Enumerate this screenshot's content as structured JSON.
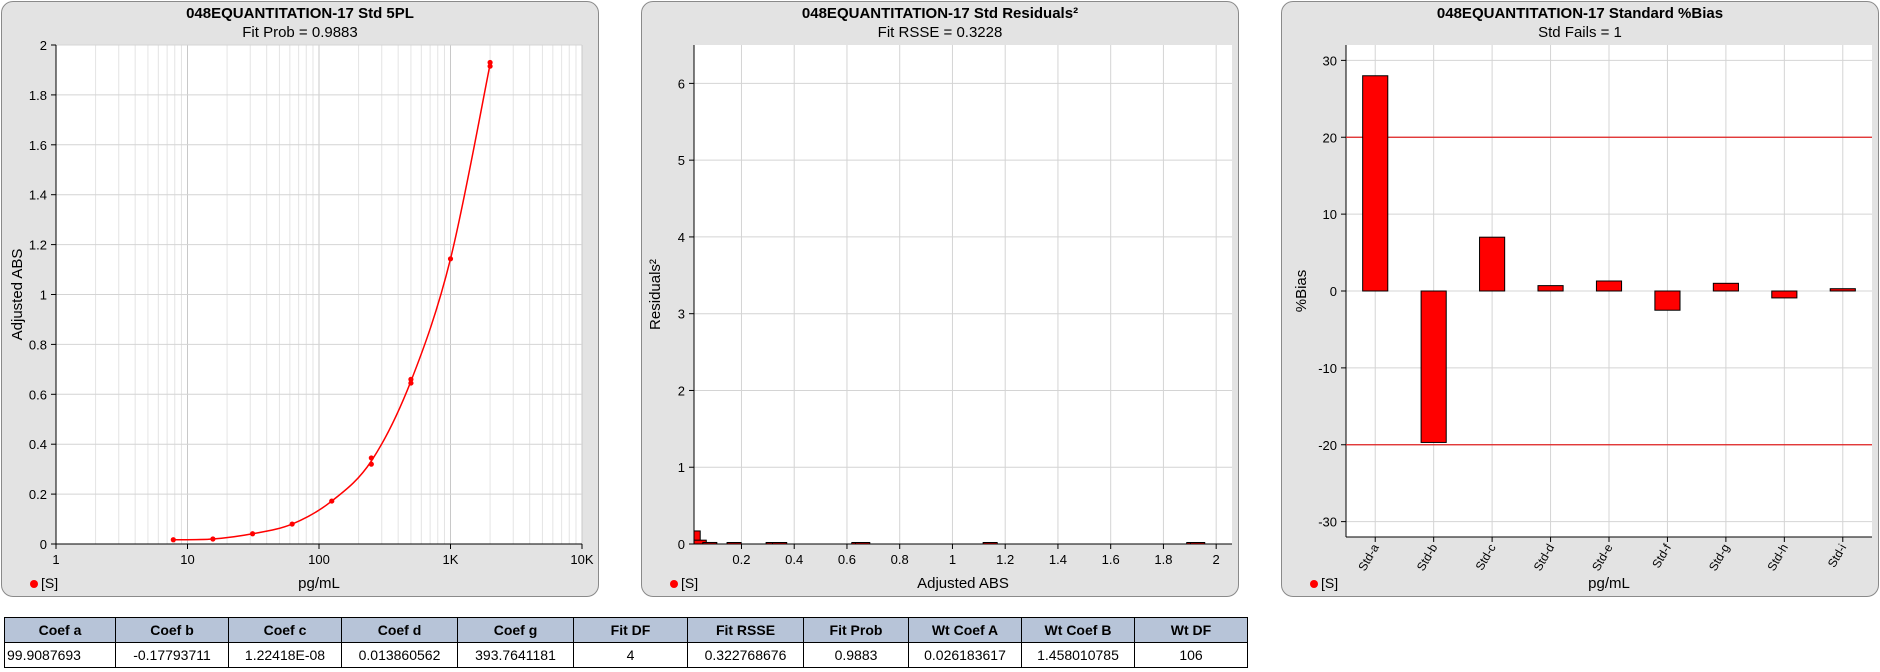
{
  "panels": [
    {
      "title": "048EQUANTITATION-17  Std 5PL",
      "subtitle": "Fit Prob = 0.9883",
      "legend": "[S]"
    },
    {
      "title": "048EQUANTITATION-17  Std  Residuals²",
      "subtitle": "Fit RSSE = 0.3228",
      "legend": "[S]"
    },
    {
      "title": "048EQUANTITATION-17  Standard %Bias",
      "subtitle": "Std Fails = 1",
      "legend": "[S]"
    }
  ],
  "chart_data": [
    {
      "type": "scatter",
      "title": "048EQUANTITATION-17  Std 5PL",
      "subtitle": "Fit Prob = 0.9883",
      "xlabel": "pg/mL",
      "ylabel": "Adjusted ABS",
      "xscale": "log",
      "xlim": [
        1,
        10000
      ],
      "ylim": [
        0,
        2
      ],
      "xticks": [
        "1",
        "10",
        "100",
        "1K",
        "10K"
      ],
      "yticks": [
        "0",
        "0.2",
        "0.4",
        "0.6",
        "0.8",
        "1",
        "1.2",
        "1.4",
        "1.6",
        "1.8",
        "2"
      ],
      "grid": true,
      "legend": "[S]",
      "series": [
        {
          "points": [
            [
              7.8,
              0.017
            ],
            [
              15.6,
              0.02
            ],
            [
              31.25,
              0.041
            ],
            [
              62.5,
              0.08
            ],
            [
              125,
              0.172
            ],
            [
              250,
              0.32
            ],
            [
              250,
              0.345
            ],
            [
              500,
              0.645
            ],
            [
              500,
              0.66
            ],
            [
              1000,
              1.143
            ],
            [
              2000,
              1.915
            ],
            [
              2000,
              1.93
            ]
          ],
          "color": "#ff0000"
        }
      ],
      "fit_curve": {
        "color": "#ff0000"
      }
    },
    {
      "type": "bar",
      "title": "048EQUANTITATION-17  Std  Residuals²",
      "subtitle": "Fit RSSE = 0.3228",
      "xlabel": "Adjusted ABS",
      "ylabel": "Residuals²",
      "xlim": [
        0.02,
        2.06
      ],
      "ylim": [
        0,
        6.5
      ],
      "xticks": [
        "0.2",
        "0.4",
        "0.6",
        "0.8",
        "1",
        "1.2",
        "1.4",
        "1.6",
        "1.8",
        "2"
      ],
      "yticks": [
        "0",
        "1",
        "2",
        "3",
        "4",
        "5",
        "6"
      ],
      "grid": true,
      "legend": "[S]",
      "series": [
        {
          "points": [
            [
              0.017,
              0.17
            ],
            [
              0.04,
              0.05
            ],
            [
              0.08,
              0.02
            ],
            [
              0.172,
              0.01
            ],
            [
              0.32,
              0.005
            ],
            [
              0.345,
              0.005
            ],
            [
              0.645,
              0.005
            ],
            [
              0.66,
              0.005
            ],
            [
              1.143,
              0.005
            ],
            [
              1.915,
              0.005
            ],
            [
              1.93,
              0.005
            ]
          ],
          "color": "#ff0000"
        }
      ]
    },
    {
      "type": "bar",
      "title": "048EQUANTITATION-17  Standard %Bias",
      "subtitle": "Std Fails = 1",
      "xlabel": "pg/mL",
      "ylabel": "%Bias",
      "categories": [
        "Std-a",
        "Std-b",
        "Std-c",
        "Std-d",
        "Std-e",
        "Std-f",
        "Std-g",
        "Std-h",
        "Std-i"
      ],
      "values": [
        28,
        -19.7,
        7,
        0.7,
        1.3,
        -2.5,
        1,
        -0.9,
        0.3
      ],
      "ylim": [
        -32,
        32
      ],
      "yticks": [
        "30",
        "20",
        "10",
        "0",
        "-10",
        "-20",
        "-30"
      ],
      "limit_lines": [
        20,
        -20
      ],
      "grid": true,
      "legend": "[S]",
      "color": "#ff0000",
      "limit_color": "#e02020"
    }
  ],
  "table": {
    "headers": [
      "Coef a",
      "Coef b",
      "Coef c",
      "Coef d",
      "Coef g",
      "Fit DF",
      "Fit RSSE",
      "Fit Prob",
      "Wt Coef A",
      "Wt Coef B",
      "Wt DF"
    ],
    "row": [
      "99.9087693",
      "-0.17793711",
      "1.22418E-08",
      "0.013860562",
      "393.7641181",
      "4",
      "0.322768676",
      "0.9883",
      "0.026183617",
      "1.458010785",
      "106"
    ]
  }
}
